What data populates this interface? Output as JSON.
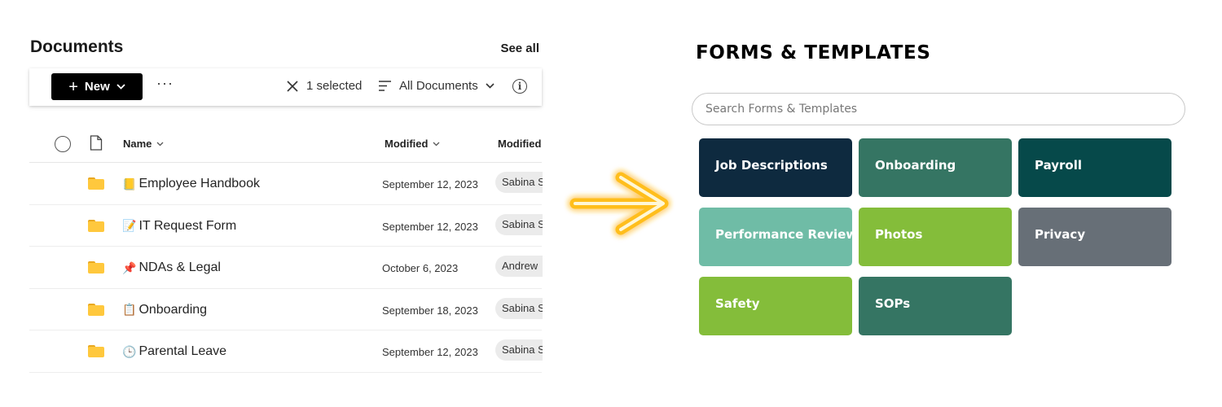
{
  "documents": {
    "title": "Documents",
    "see_all": "See all",
    "toolbar": {
      "new_label": "New",
      "more_label": "···",
      "selected_label": "1 selected",
      "view_label": "All Documents"
    },
    "columns": {
      "name": "Name",
      "modified": "Modified",
      "modified_by": "Modified By"
    },
    "rows": [
      {
        "emoji": "📒",
        "name": "Employee Handbook",
        "modified": "September 12, 2023",
        "modified_by": "Sabina S"
      },
      {
        "emoji": "📝",
        "name": "IT Request Form",
        "modified": "September 12, 2023",
        "modified_by": "Sabina S"
      },
      {
        "emoji": "📌",
        "name": "NDAs & Legal",
        "modified": "October 6, 2023",
        "modified_by": "Andrew"
      },
      {
        "emoji": "📋",
        "name": "Onboarding",
        "modified": "September 18, 2023",
        "modified_by": "Sabina S"
      },
      {
        "emoji": "🕒",
        "name": "Parental Leave",
        "modified": "September 12, 2023",
        "modified_by": "Sabina S"
      }
    ]
  },
  "forms": {
    "title": "FORMS & TEMPLATES",
    "search_placeholder": "Search Forms & Templates",
    "tiles": [
      {
        "label": "Job Descriptions",
        "color": "#0e2a3f"
      },
      {
        "label": "Onboarding",
        "color": "#357563"
      },
      {
        "label": "Payroll",
        "color": "#06494a"
      },
      {
        "label": "Performance Review",
        "color": "#6fbca6"
      },
      {
        "label": "Photos",
        "color": "#84bd3a"
      },
      {
        "label": "Privacy",
        "color": "#676f77"
      },
      {
        "label": "Safety",
        "color": "#84bd3a"
      },
      {
        "label": "SOPs",
        "color": "#357563"
      }
    ]
  },
  "arrow": {
    "color": "#ffbe1a",
    "glow": "#ffb300"
  }
}
